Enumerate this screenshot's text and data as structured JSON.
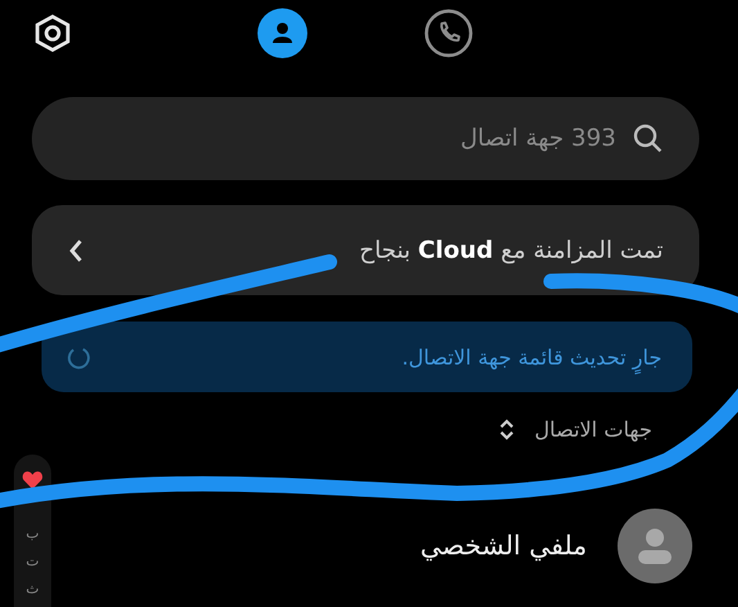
{
  "tabs": [
    {
      "kind": "settings",
      "selected": false
    },
    {
      "kind": "contacts",
      "selected": true
    },
    {
      "kind": "calls",
      "selected": false
    }
  ],
  "search": {
    "placeholder": "393 جهة اتصال"
  },
  "sync_card": {
    "message": "تمت المزامنة مع **Cloud** بنجاح"
  },
  "status_banner": {
    "message": "جارٍ تحديث قائمة جهة الاتصال."
  },
  "sort": {
    "label": "جهات الاتصال"
  },
  "index_bar": [
    {
      "kind": "favorite"
    },
    {
      "kind": "letter",
      "label": "ب"
    },
    {
      "kind": "letter",
      "label": "ت"
    },
    {
      "kind": "letter",
      "label": "ث"
    }
  ],
  "profile": {
    "label": "ملفي الشخصي"
  },
  "annotation_scribble": true
}
